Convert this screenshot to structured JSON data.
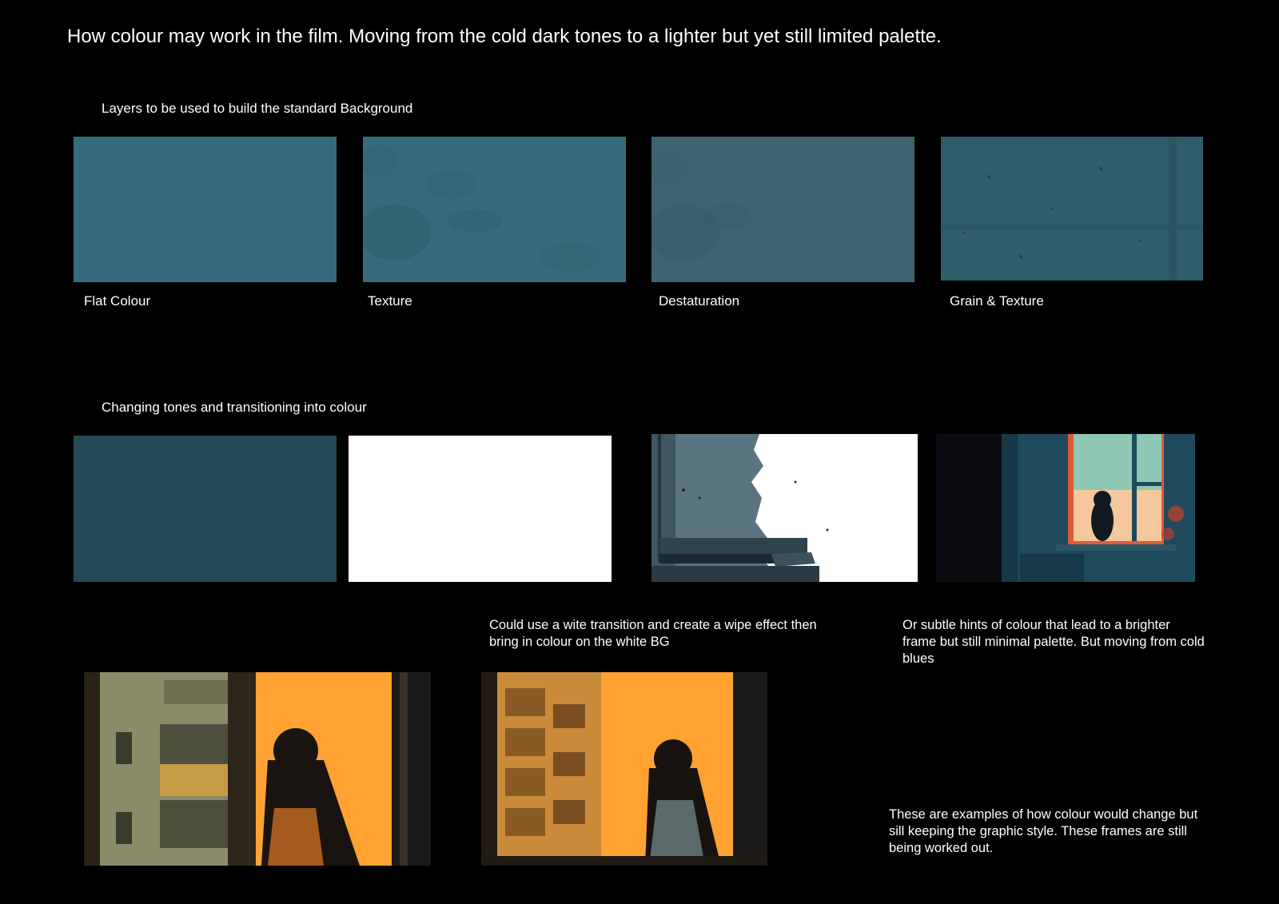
{
  "title": "How colour may work in the film. Moving from the cold dark tones to a lighter but yet still limited palette.",
  "layers": {
    "heading": "Layers to be used to build the standard Background",
    "items": [
      {
        "label": "Flat Colour",
        "color": "#356b7c"
      },
      {
        "label": "Texture",
        "color": "#366b7b"
      },
      {
        "label": "Destaturation",
        "color": "#3f6470"
      },
      {
        "label": "Grain & Texture",
        "color": "#31606f"
      }
    ]
  },
  "transition": {
    "heading": "Changing tones and transitioning into colour",
    "colors": {
      "dark_teal": "#244a55",
      "white": "#ffffff",
      "orange": "#ffa232"
    }
  },
  "notes": {
    "wipe": "Could use a wite transition and create a wipe effect then bring in colour on the white BG",
    "hints": "Or subtle hints of colour that lead to a brighter frame but still minimal palette. But moving from cold blues",
    "examples": "These are examples of how colour would change but sill keeping the graphic style. These frames are still being worked out."
  }
}
